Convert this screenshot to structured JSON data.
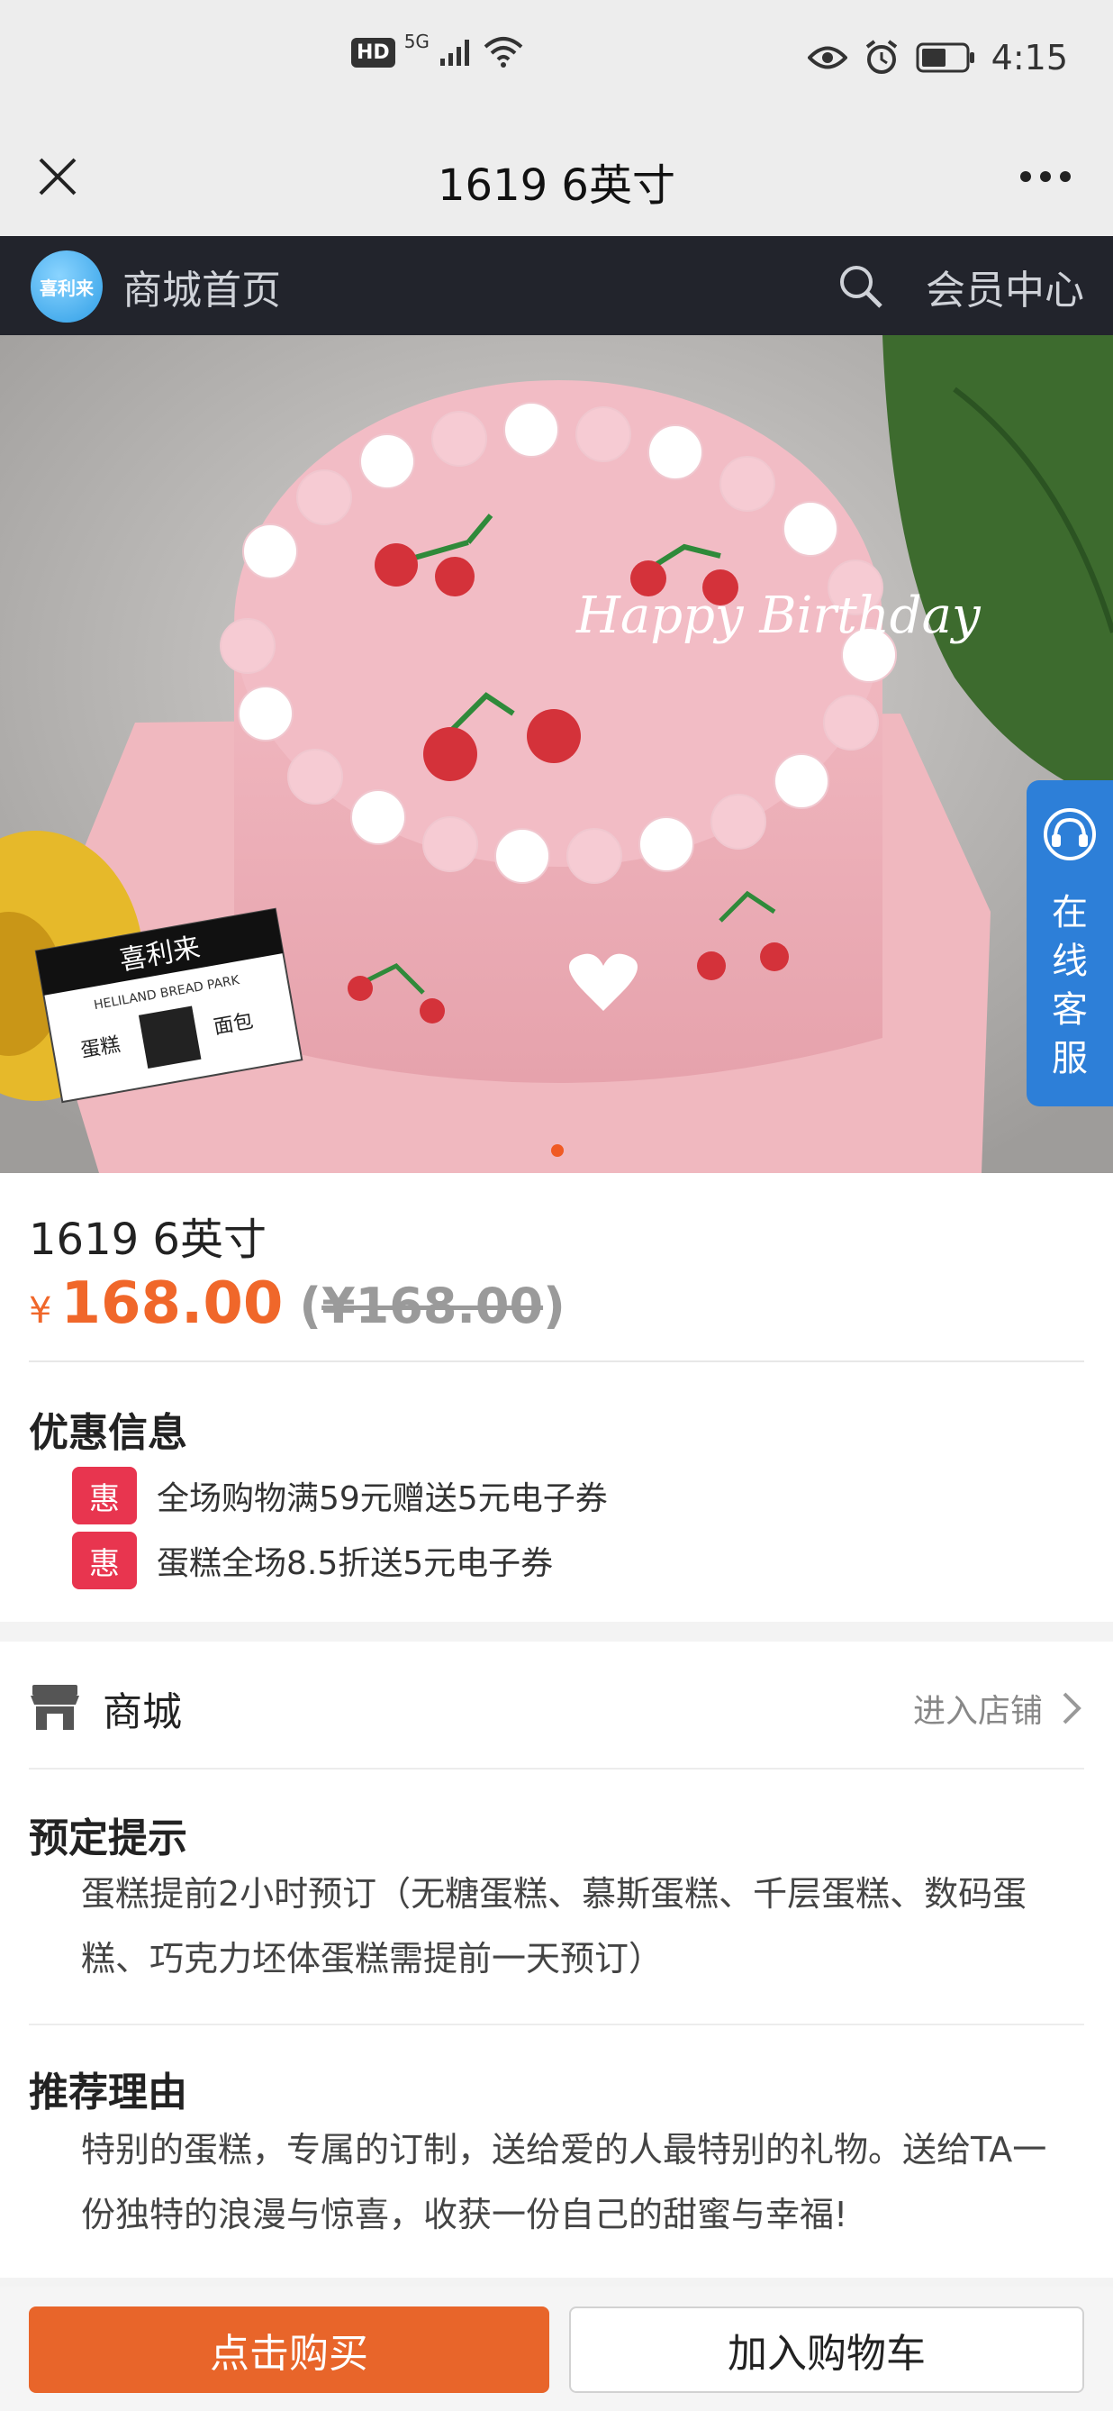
{
  "status_bar": {
    "hd": "HD",
    "network": "5G",
    "time": "4:15"
  },
  "titlebar": {
    "title": "1619 6英寸"
  },
  "shop_nav": {
    "home_label": "商城首页",
    "member_label": "会员中心"
  },
  "hero": {
    "slide_count": 1,
    "active_slide": 1,
    "cake_writing": "Happy Birthday",
    "card_brand": "喜利来",
    "card_sub": "HELILAND BREAD PARK",
    "card_left": "蛋糕",
    "card_right": "面包"
  },
  "customer_service": {
    "label": "在线客服"
  },
  "product": {
    "name": "1619 6英寸",
    "currency": "¥",
    "price": "168.00",
    "original_price_prefix": "(",
    "original_price": "¥168.00",
    "original_price_suffix": ")"
  },
  "promotions": {
    "title": "优惠信息",
    "items": [
      {
        "tag": "惠",
        "text": "全场购物满59元赠送5元电子券"
      },
      {
        "tag": "惠",
        "text": "蛋糕全场8.5折送5元电子券"
      }
    ]
  },
  "store": {
    "name": "商城",
    "enter_label": "进入店铺"
  },
  "booking_tip": {
    "title": "预定提示",
    "body": "蛋糕提前2小时预订（无糖蛋糕、慕斯蛋糕、千层蛋糕、数码蛋糕、巧克力坯体蛋糕需提前一天预订）"
  },
  "recommend": {
    "title": "推荐理由",
    "body": "特别的蛋糕，专属的订制，送给爱的人最特别的礼物。送给TA一份独特的浪漫与惊喜，收获一份自己的甜蜜与幸福!"
  },
  "actions": {
    "buy_label": "点击购买",
    "cart_label": "加入购物车"
  },
  "colors": {
    "accent": "#e8652a",
    "price": "#f0672a",
    "promo_tag": "#e8354f",
    "nav_bg": "#22242c"
  }
}
